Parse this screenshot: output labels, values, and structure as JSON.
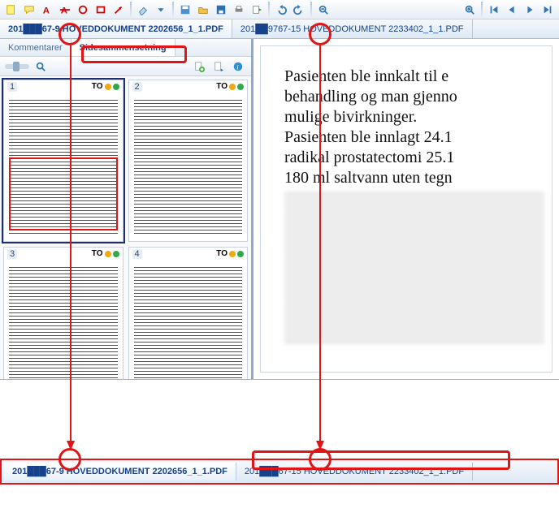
{
  "toolbar_icons": [
    "note-icon",
    "comment-icon",
    "text-red-a-icon",
    "text-strike-a-icon",
    "circle-icon",
    "rect-icon",
    "arrow-icon",
    "sep",
    "eraser-icon",
    "dropdown-icon",
    "sep",
    "save-icon",
    "folder-icon",
    "floppy-icon",
    "print-icon",
    "export-icon",
    "sep",
    "undo-icon",
    "redo-icon",
    "sep",
    "zoom-out-icon",
    "space",
    "zoom-in-icon",
    "sep",
    "first-icon",
    "prev-icon",
    "next-icon",
    "last-icon"
  ],
  "tabs": [
    {
      "label": "201███67-9 HOVEDDOKUMENT 2202656_1_1.PDF",
      "key": "doc1",
      "active": true
    },
    {
      "label": "201██9767-15 HOVEDDOKUMENT 2233402_1_1.PDF",
      "key": "doc2",
      "active": false
    }
  ],
  "subtabs": [
    {
      "label": "Kommentarer",
      "key": "comments"
    },
    {
      "label": "Sidesammensetning",
      "key": "thumbs",
      "active": true
    }
  ],
  "thumb_tools": {
    "zoom_slider": "zoom",
    "add_page": "add",
    "move_page": "move",
    "info": "info"
  },
  "thumbnails": [
    {
      "num": "1",
      "head": "TO",
      "selected": true
    },
    {
      "num": "2",
      "head": "TO"
    },
    {
      "num": "3",
      "head": "TO"
    },
    {
      "num": "4",
      "head": "TO"
    }
  ],
  "document_text": "Pasienten ble innkalt til e\nbehandling og man gjenno\nmulige bivirkninger.\nPasienten ble innlagt 24.1\nradikal prostatectomi 25.1\n180 ml saltvann uten tegn",
  "bottom_tabs": [
    {
      "label": "201███67-9 HOVEDDOKUMENT 2202656_1_1.PDF",
      "active": true
    },
    {
      "label": "201███67-15 HOVEDDOKUMENT 2233402_1_1.PDF",
      "active": false
    }
  ]
}
